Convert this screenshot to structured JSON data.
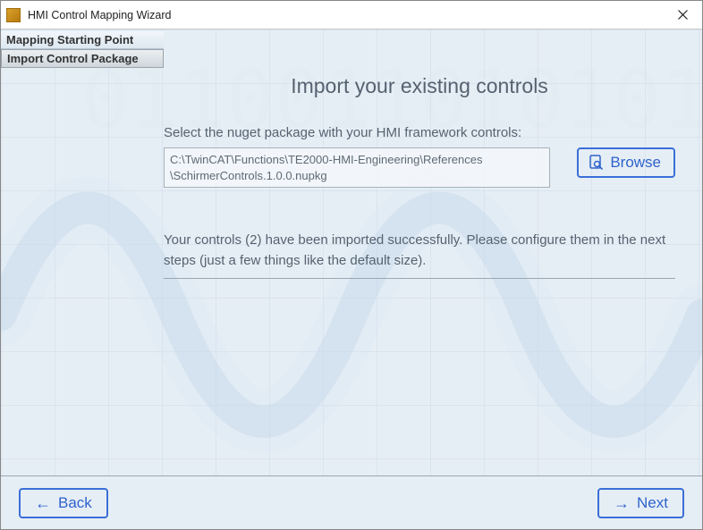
{
  "window": {
    "title": "HMI Control Mapping Wizard"
  },
  "sidebar": {
    "steps": [
      {
        "label": "Mapping Starting Point"
      },
      {
        "label": "Import Control Package"
      }
    ],
    "active_index": 1
  },
  "page": {
    "title": "Import your existing controls",
    "instruction": "Select the nuget package with your HMI framework controls:",
    "package_path": "C:\\TwinCAT\\Functions\\TE2000-HMI-Engineering\\References\\SchirmerControls.1.0.0.nupkg",
    "browse_label": "Browse",
    "status": "Your controls (2) have been imported successfully. Please configure them in the next steps (just a few things like the default size)."
  },
  "footer": {
    "back_label": "Back",
    "next_label": "Next"
  }
}
